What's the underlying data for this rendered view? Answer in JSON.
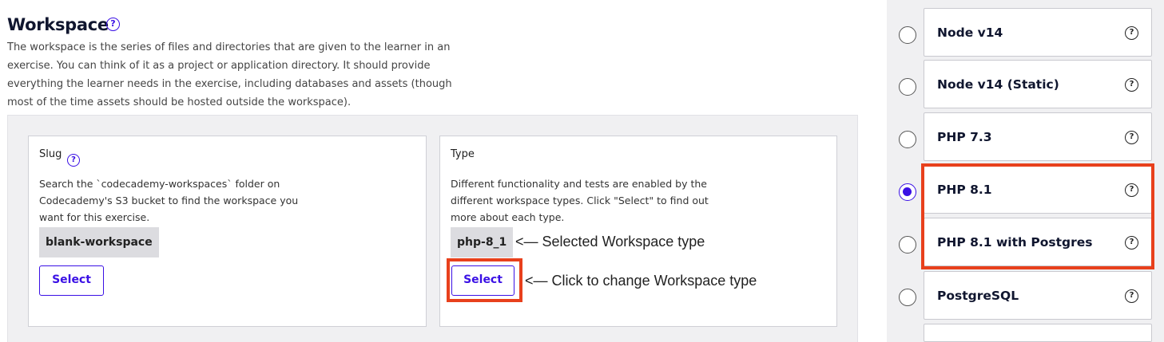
{
  "workspace": {
    "title": "Workspace",
    "help_glyph": "?",
    "description": "The workspace is the series of files and directories that are given to the learner in an exercise. You can think of it as a project or application directory. It should provide everything the learner needs in the exercise, including databases and assets (though most of the time assets should be hosted outside the workspace)."
  },
  "slug": {
    "label": "Slug",
    "help_glyph": "?",
    "description": "Search the `codecademy-workspaces` folder on Codecademy's S3 bucket to find the workspace you want for this exercise.",
    "value": "blank-workspace",
    "select_label": "Select"
  },
  "type": {
    "label": "Type",
    "description": "Different functionality and tests are enabled by the different workspace types. Click \"Select\" to find out more about each type.",
    "value": "php-8_1",
    "select_label": "Select"
  },
  "annotations": {
    "selected_type": "<— Selected Workspace type",
    "change_type": "<— Click to change Workspace type"
  },
  "options": [
    {
      "label": "Node v14",
      "selected": false,
      "help_glyph": "?"
    },
    {
      "label": "Node v14 (Static)",
      "selected": false,
      "help_glyph": "?"
    },
    {
      "label": "PHP 7.3",
      "selected": false,
      "help_glyph": "?"
    },
    {
      "label": "PHP 8.1",
      "selected": true,
      "help_glyph": "?"
    },
    {
      "label": "PHP 8.1 with Postgres",
      "selected": false,
      "help_glyph": "?"
    },
    {
      "label": "PostgreSQL",
      "selected": false,
      "help_glyph": "?"
    }
  ],
  "colors": {
    "accent": "#3a10e5",
    "highlight": "#e8401c",
    "panel_bg": "#f0f0f2"
  }
}
